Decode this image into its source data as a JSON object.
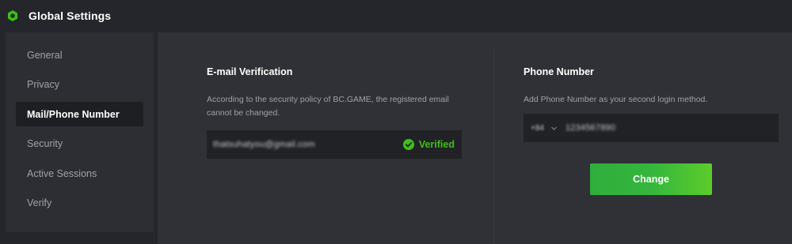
{
  "header": {
    "title": "Global Settings",
    "logo_icon": "bcgame-logo-icon"
  },
  "sidebar": {
    "items": [
      {
        "label": "General"
      },
      {
        "label": "Privacy"
      },
      {
        "label": "Mail/Phone Number",
        "active": true
      },
      {
        "label": "Security"
      },
      {
        "label": "Active Sessions"
      },
      {
        "label": "Verify"
      }
    ]
  },
  "email_section": {
    "title": "E-mail Verification",
    "description": "According to the security policy of BC.GAME, the registered email cannot be changed.",
    "email_value": "thatsuhatyou@gmail.com",
    "verified_label": "Verified",
    "verified_icon": "check-circle-icon"
  },
  "phone_section": {
    "title": "Phone Number",
    "description": "Add Phone Number as your second login method.",
    "country_code": "+84",
    "phone_value": "1234567890",
    "change_label": "Change"
  },
  "colors": {
    "accent_green": "#3bc117",
    "button_gradient_start": "#2fae3c",
    "button_gradient_end": "#5ccc2a",
    "background": "#24262b",
    "panel": "#2f3136",
    "sidebar_bg": "#2c2e33",
    "field_bg": "#212226"
  }
}
